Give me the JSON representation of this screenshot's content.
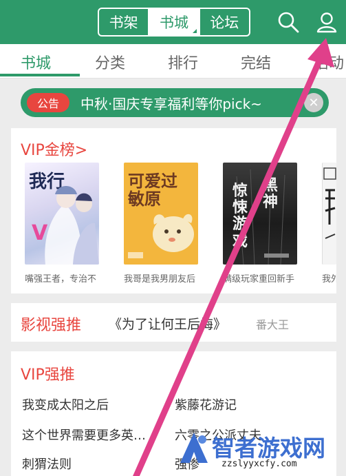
{
  "header": {
    "segments": [
      "书架",
      "书城",
      "论坛"
    ],
    "active_segment": "书城",
    "icons": [
      "search-icon",
      "user-icon"
    ]
  },
  "subtabs": [
    "书城",
    "分类",
    "排行",
    "完结",
    "活动"
  ],
  "notice": {
    "badge": "公告",
    "text": "中秋·国庆专享福利等你pick~"
  },
  "vip": {
    "title": "VIP金榜>",
    "books": [
      {
        "name": "嘴强王者，专治不",
        "cover_text": "我行"
      },
      {
        "name": "我哥是我男朋友后",
        "cover_text": "可爱过敏原"
      },
      {
        "name": "满级玩家重回新手",
        "cover_text": "惊悚游戏"
      },
      {
        "name": "我外",
        "cover_text": ""
      }
    ]
  },
  "film": {
    "title": "影视强推",
    "book": "《为了让何王后悔》",
    "author": "番大王"
  },
  "recommend": {
    "title": "VIP强推",
    "items": [
      "我变成太阳之后",
      "紫藤花游记",
      "这个世界需要更多英…",
      "六零之公派丈夫",
      "刺猬法则",
      "强惨"
    ]
  },
  "watermark": {
    "main": "智者游戏网",
    "sub": "zzslyyxcfy.com"
  },
  "colors": {
    "brand": "#2e9a6a",
    "accent": "#e8463f",
    "arrow": "#e0408a"
  }
}
